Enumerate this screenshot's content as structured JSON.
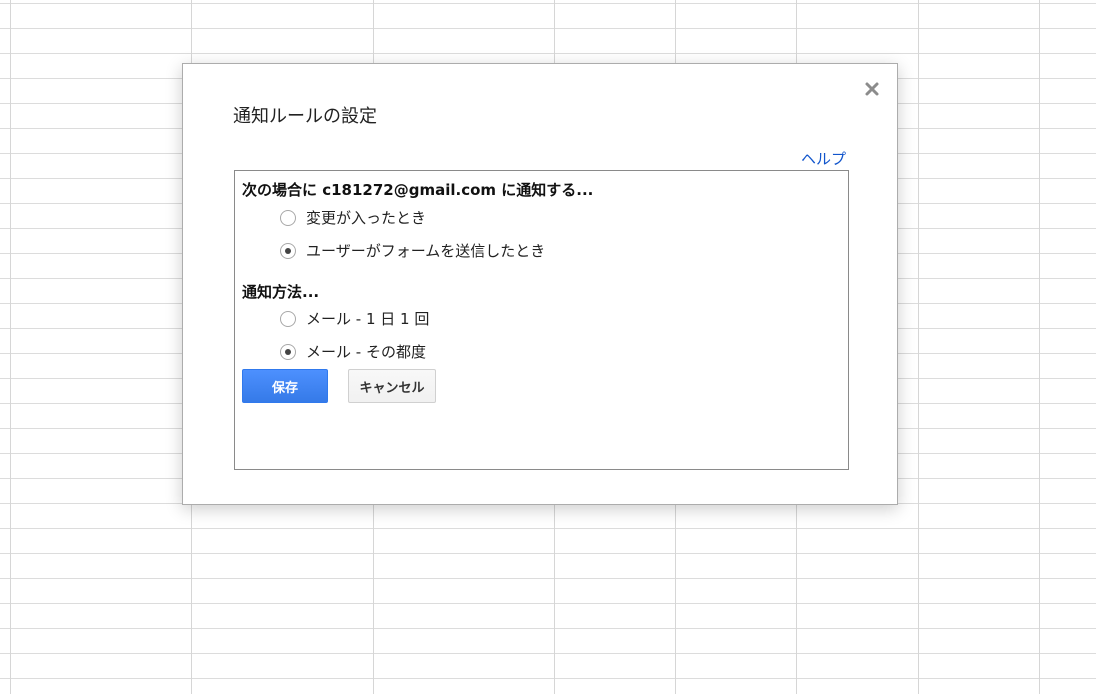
{
  "dialog": {
    "title": "通知ルールの設定",
    "close_icon": "close-icon",
    "help_label": "ヘルプ",
    "notify_heading": "次の場合に c181272@gmail.com に通知する...",
    "notify_options": [
      {
        "label": "変更が入ったとき",
        "checked": false
      },
      {
        "label": "ユーザーがフォームを送信したとき",
        "checked": true
      }
    ],
    "method_heading": "通知方法...",
    "method_options": [
      {
        "label": "メール - 1 日 1 回",
        "checked": false
      },
      {
        "label": "メール - その都度",
        "checked": true
      }
    ],
    "save_label": "保存",
    "cancel_label": "キャンセル"
  },
  "colors": {
    "accent": "#4d90fe",
    "link": "#1155cc"
  }
}
